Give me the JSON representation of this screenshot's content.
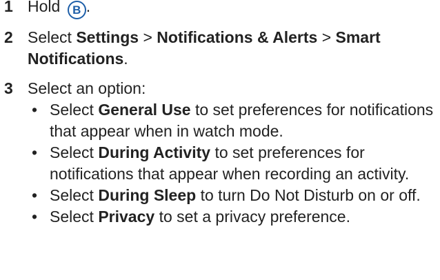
{
  "steps": [
    {
      "number": "1",
      "text_before": "Hold",
      "key_label": "B",
      "text_after": "."
    },
    {
      "number": "2",
      "text_before": "Select",
      "path": [
        "Settings",
        "Notifications & Alerts",
        "Smart Notifications"
      ],
      "separator": ">",
      "text_after": "."
    },
    {
      "number": "3",
      "text": "Select an option:",
      "options": [
        {
          "bold": "General Use",
          "rest": "to set preferences for notifications that appear when in watch mode."
        },
        {
          "bold": "During Activity",
          "rest": "to set preferences for notifications that appear when recording an activity."
        },
        {
          "bold": "During Sleep",
          "rest": "to turn Do Not Disturb on or off."
        },
        {
          "bold": "Privacy",
          "rest": "to set a privacy preference."
        }
      ]
    }
  ],
  "option_prefix": "Select",
  "bullet_char": "•",
  "colors": {
    "text": "#222222",
    "key_badge": "#1d5ea8"
  }
}
